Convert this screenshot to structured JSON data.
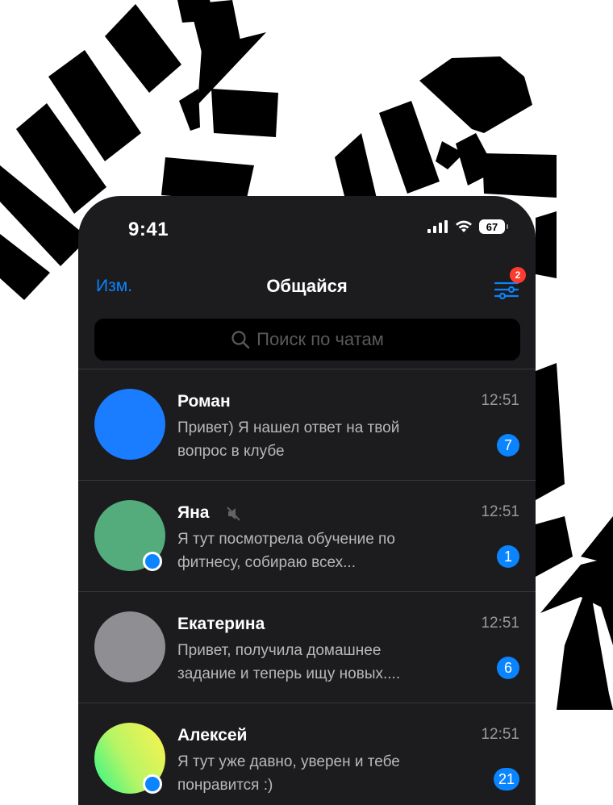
{
  "status": {
    "time": "9:41",
    "battery": "67"
  },
  "nav": {
    "edit_label": "Изм.",
    "title": "Общайся",
    "filter_badge": "2"
  },
  "search": {
    "placeholder": "Поиск по чатам"
  },
  "chats": [
    {
      "name": "Роман",
      "line1": "Привет) Я нашел ответ на твой",
      "line2": "вопрос в клубе",
      "time": "12:51",
      "unread": "7",
      "avatar_color": "#1a7cff",
      "muted": false,
      "online": false
    },
    {
      "name": "Яна",
      "line1": "Я тут посмотрела обучение по",
      "line2": "фитнесу, собираю всех...",
      "time": "12:51",
      "unread": "1",
      "avatar_color": "#54ac7c",
      "muted": true,
      "online": true
    },
    {
      "name": "Екатерина",
      "line1": "Привет, получила домашнее",
      "line2": "задание и теперь ищу новых....",
      "time": "12:51",
      "unread": "6",
      "avatar_color": "#8e8e93",
      "muted": false,
      "online": false
    },
    {
      "name": "Алексей",
      "line1": "Я тут уже давно, уверен и тебе",
      "line2": "понравится :)",
      "time": "12:51",
      "unread": "21",
      "avatar_color": "gradient-green-yellow",
      "muted": false,
      "online": true
    }
  ],
  "colors": {
    "accent": "#0a84ff",
    "background": "#1c1c1e",
    "badge_red": "#ff3b30"
  }
}
